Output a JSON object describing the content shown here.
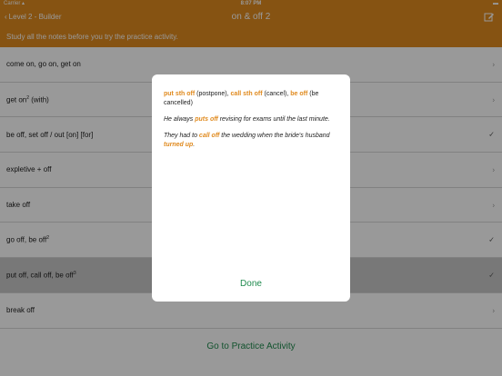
{
  "status": {
    "carrier": "Carrier ▴",
    "time": "8:07 PM",
    "battery": "▬"
  },
  "nav": {
    "back_label": "Level 2 - Builder",
    "title": "on & off 2"
  },
  "banner": "Study all the notes before you try the practice activity.",
  "rows": [
    {
      "text": "come on, go on, get on",
      "sup": "",
      "accessory": "›"
    },
    {
      "text": "get on",
      "sup": "2",
      "suffix": " (with)",
      "accessory": "›"
    },
    {
      "text": "be off, set off / out [on] [for]",
      "sup": "",
      "accessory": "✓"
    },
    {
      "text": "expletive + off",
      "sup": "",
      "accessory": "›"
    },
    {
      "text": "take off",
      "sup": "",
      "accessory": "›"
    },
    {
      "text": "go off, be off",
      "sup": "2",
      "accessory": "✓"
    },
    {
      "text": "put off, call off, be off",
      "sup": "3",
      "accessory": "✓"
    },
    {
      "text": "break off",
      "sup": "",
      "accessory": "›"
    }
  ],
  "practice_label": "Go to Practice Activity",
  "modal": {
    "line1": {
      "t1": "put sth off",
      "t2": " (postpone), ",
      "t3": "call sth off",
      "t4": " (cancel), ",
      "t5": "be off",
      "t6": " (be cancelled)"
    },
    "line2": {
      "t1": "He always ",
      "t2": "puts off",
      "t3": " revising for exams until the last minute."
    },
    "line3": {
      "t1": "They had to ",
      "t2": "call off",
      "t3": " the wedding when the bride's husband ",
      "t4": "turned up",
      "t5": "."
    },
    "done_label": "Done"
  },
  "colors": {
    "accent": "#e08a1e",
    "green": "#1f8a4d"
  }
}
